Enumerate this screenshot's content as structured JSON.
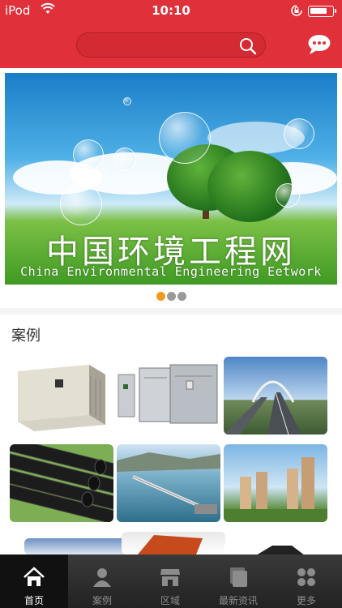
{
  "status": {
    "carrier": "iPod",
    "time": "10:10",
    "battery_level": 0.75
  },
  "banner": {
    "title_cn": "中国环境工程网",
    "title_en": "China Environmental Engineering Eetwork",
    "dots": [
      {
        "active": true
      },
      {
        "active": false
      },
      {
        "active": false
      }
    ]
  },
  "section": {
    "title": "案例"
  },
  "tabs": [
    {
      "label": "首页",
      "icon": "home-icon",
      "active": true
    },
    {
      "label": "案例",
      "icon": "person-icon",
      "active": false
    },
    {
      "label": "区域",
      "icon": "store-icon",
      "active": false
    },
    {
      "label": "最新资讯",
      "icon": "news-icon",
      "active": false
    },
    {
      "label": "更多",
      "icon": "more-icon",
      "active": false
    }
  ],
  "colors": {
    "brand_red": "#e0303a",
    "dot_active": "#f29a1c",
    "tabbar": "#2b2b2b"
  }
}
